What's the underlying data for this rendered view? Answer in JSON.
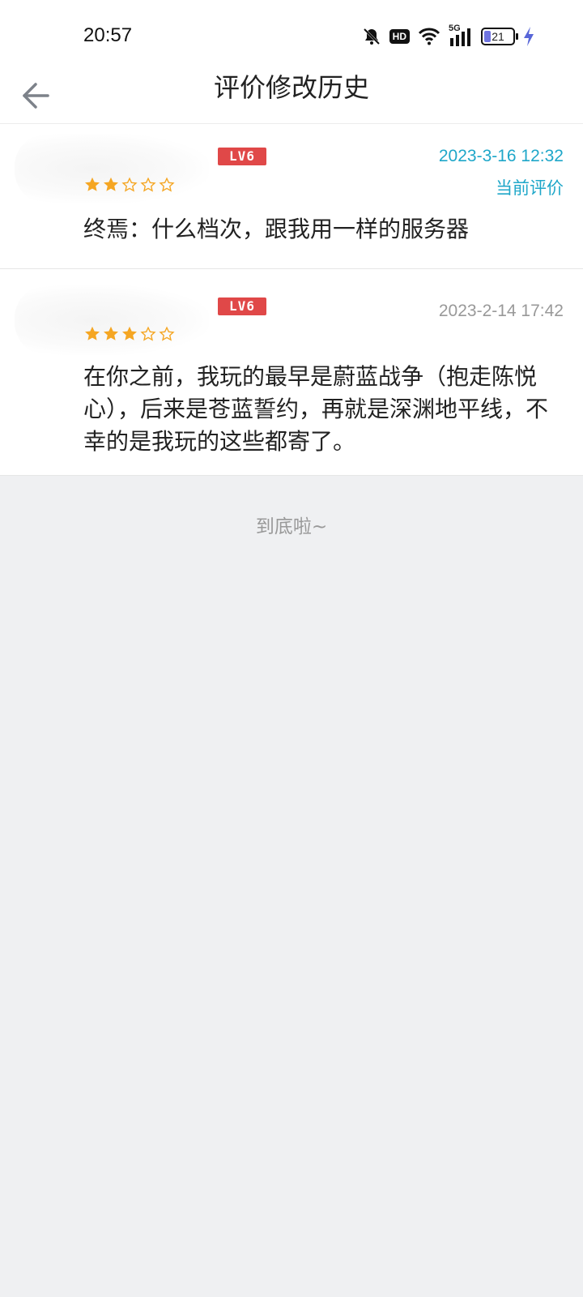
{
  "status_bar": {
    "time": "20:57",
    "icons": [
      "mute-bell-icon",
      "hd-icon",
      "wifi-icon",
      "5g-signal-icon",
      "battery-icon",
      "charging-icon"
    ],
    "hd_label": "HD",
    "network_label": "5G",
    "battery_level": "21"
  },
  "nav": {
    "back_icon": "back-arrow-icon",
    "title": "评价修改历史"
  },
  "reviews": [
    {
      "level_badge": "LV6",
      "rating": 2,
      "max_rating": 5,
      "time": "2023-3-16 12:32",
      "time_color": "#1fa7c9",
      "current_tag": "当前评价",
      "text": "终焉：什么档次，跟我用一样的服务器"
    },
    {
      "level_badge": "LV6",
      "rating": 3,
      "max_rating": 5,
      "time": "2023-2-14 17:42",
      "time_color": "#999999",
      "text": "在你之前，我玩的最早是蔚蓝战争（抱走陈悦心），后来是苍蓝誓约，再就是深渊地平线，不幸的是我玩的这些都寄了。"
    }
  ],
  "footer": {
    "end_text": "到底啦~"
  },
  "colors": {
    "accent": "#1fa7c9",
    "star": "#f5a623",
    "badge": "#e04848",
    "background": "#eff0f2"
  }
}
